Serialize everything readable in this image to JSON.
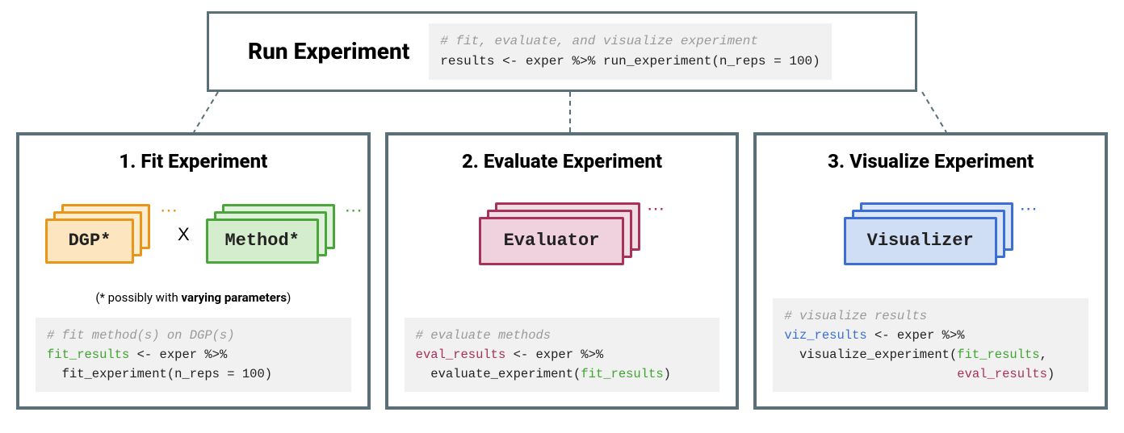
{
  "top": {
    "title": "Run Experiment",
    "code_comment": "# fit, evaluate, and visualize experiment",
    "code_line": "results <- exper %>% run_experiment(n_reps = 100)"
  },
  "panels": {
    "fit": {
      "title": "1. Fit Experiment",
      "dgp_label": "DGP*",
      "method_label": "Method*",
      "x": "X",
      "footnote_pre": "(* possibly with ",
      "footnote_bold": "varying parameters",
      "footnote_post": ")",
      "code_comment": "# fit method(s) on DGP(s)",
      "code_var": "fit_results",
      "code_rest1": " <- exper %>%",
      "code_line2": "  fit_experiment(n_reps = 100)"
    },
    "eval": {
      "title": "2. Evaluate Experiment",
      "label": "Evaluator",
      "code_comment": "# evaluate methods",
      "code_var": "eval_results",
      "code_rest1": " <- exper %>%",
      "code_line2a": "  evaluate_experiment(",
      "code_arg_green": "fit_results",
      "code_line2b": ")"
    },
    "viz": {
      "title": "3. Visualize Experiment",
      "label": "Visualizer",
      "code_comment": "# visualize results",
      "code_var": "viz_results",
      "code_rest1": " <- exper %>%",
      "code_line2a": "  visualize_experiment(",
      "code_arg_green": "fit_results",
      "code_sep": ",",
      "code_line3_pad": "                       ",
      "code_arg_maroon": "eval_results",
      "code_line3b": ")"
    }
  }
}
